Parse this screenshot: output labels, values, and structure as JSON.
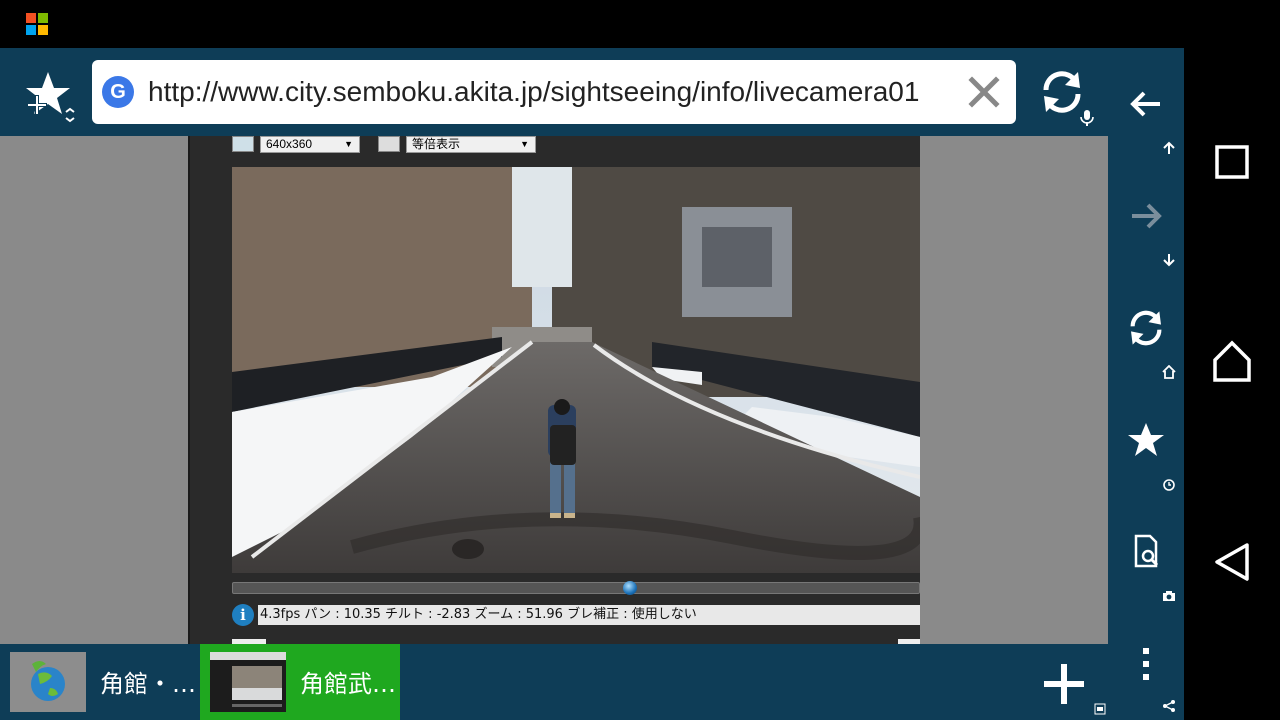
{
  "browser": {
    "url": "http://www.city.semboku.akita.jp/sightseeing/info/livecamera01",
    "search_engine_letter": "G"
  },
  "camera_controls": {
    "resolution": "640x360",
    "display_mode": "等倍表示",
    "status_text": "4.3fps パン : 10.35 チルト : -2.83 ズーム : 51.96 ブレ補正 : 使用しない",
    "info_icon_label": "i",
    "pan_position_fraction": 0.58
  },
  "tabs": [
    {
      "title": "角館・…",
      "active": false
    },
    {
      "title": "角館武…",
      "active": true
    }
  ],
  "icons": {
    "tab_tool": "add-bookmark-icon",
    "clear": "close-icon",
    "reload": "reload-icon",
    "mic": "mic-icon",
    "back": "arrow-left-icon",
    "forward": "arrow-right-icon",
    "page_up": "arrow-up-icon",
    "page_down": "arrow-down-icon",
    "home": "home-icon",
    "bookmark": "star-icon",
    "alarm": "alarm-icon",
    "find": "find-in-page-icon",
    "camera": "camera-icon",
    "menu": "more-vert-icon",
    "share": "share-icon",
    "new_tab": "plus-icon",
    "nav_recents": "recents-icon",
    "nav_home": "home-nav-icon",
    "nav_back": "back-nav-icon"
  },
  "colors": {
    "toolbar_bg": "#0e3d57",
    "active_tab": "#1fa81f",
    "content_bg": "#8a8a8a"
  }
}
